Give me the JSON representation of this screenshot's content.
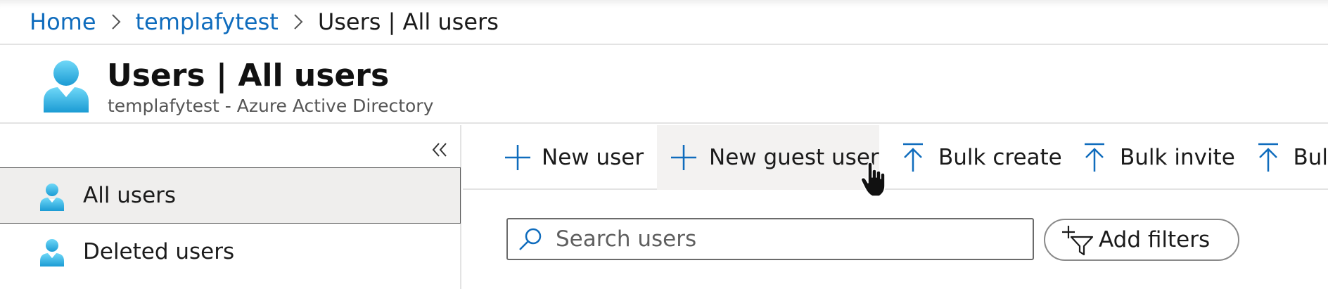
{
  "breadcrumb": {
    "items": [
      "Home",
      "templafytest"
    ],
    "current": "Users | All users"
  },
  "header": {
    "title": "Users | All users",
    "subtitle": "templafytest - Azure Active Directory",
    "icon": "user-icon"
  },
  "sidebar": {
    "collapse_icon": "double-chevron-left-icon",
    "items": [
      {
        "label": "All users",
        "icon": "user-icon",
        "active": true
      },
      {
        "label": "Deleted users",
        "icon": "user-icon",
        "active": false
      }
    ]
  },
  "commands": [
    {
      "label": "New user",
      "icon": "plus-icon"
    },
    {
      "label": "New guest user",
      "icon": "plus-icon"
    },
    {
      "label": "Bulk create",
      "icon": "upload-icon"
    },
    {
      "label": "Bulk invite",
      "icon": "upload-icon"
    },
    {
      "label": "Bul",
      "icon": "upload-icon"
    }
  ],
  "search": {
    "placeholder": "Search users",
    "value": ""
  },
  "filters": {
    "label": "Add filters",
    "icon": "add-filter-icon"
  },
  "colors": {
    "accent": "#0f6cbd",
    "user_icon_light": "#5ed0f5",
    "user_icon_dark": "#1a9fd6"
  }
}
